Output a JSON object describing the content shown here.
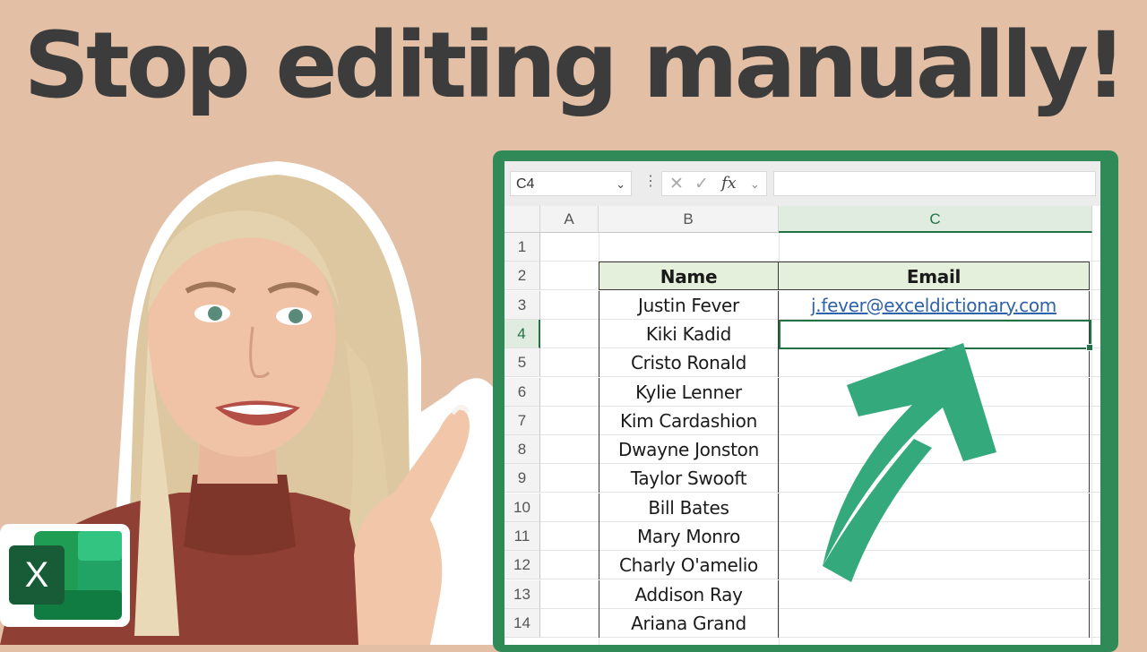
{
  "headline": "Stop editing manually!",
  "formula_bar": {
    "name_box": "C4",
    "cancel_glyph": "✕",
    "enter_glyph": "✓",
    "fx_label": "fx",
    "formula": ""
  },
  "columns": [
    "A",
    "B",
    "C"
  ],
  "rows": [
    "1",
    "2",
    "3",
    "4",
    "5",
    "6",
    "7",
    "8",
    "9",
    "10",
    "11",
    "12",
    "13",
    "14"
  ],
  "table": {
    "headers": {
      "name": "Name",
      "email": "Email"
    },
    "names": [
      "Justin Fever",
      "Kiki Kadid",
      "Cristo Ronald",
      "Kylie Lenner",
      "Kim Cardashion",
      "Dwayne Jonston",
      "Taylor Swooft",
      "Bill Bates",
      "Mary Monro",
      "Charly O'amelio",
      "Addison Ray",
      "Ariana Grand"
    ],
    "emails": [
      "j.fever@exceldictionary.com",
      "",
      "",
      "",
      "",
      "",
      "",
      "",
      "",
      "",
      "",
      ""
    ]
  },
  "logo": {
    "letter": "X",
    "icon": "excel-logo-icon"
  },
  "colors": {
    "background": "#e2bfa5",
    "accent": "#2f8a57",
    "arrow": "#34aa7c",
    "headline": "#3c3c3c"
  }
}
